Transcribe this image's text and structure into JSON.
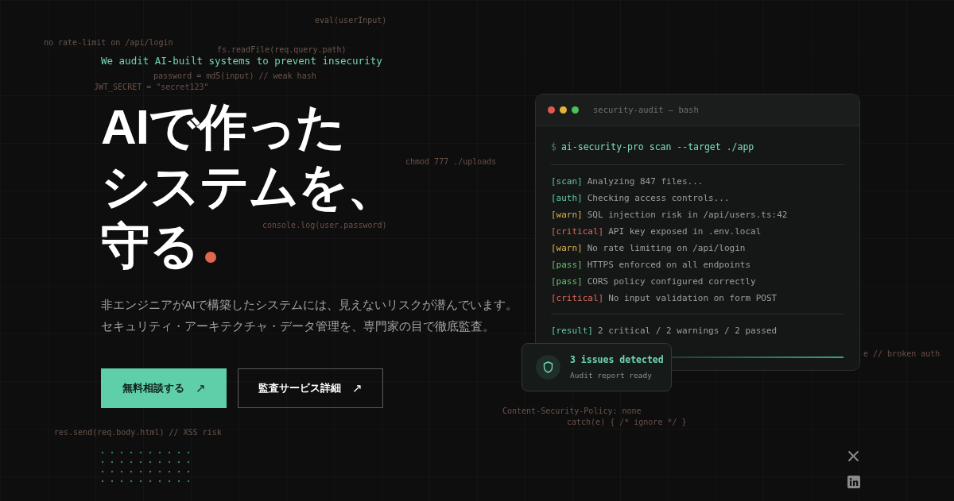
{
  "background_code": [
    {
      "text": "eval(userInput)"
    },
    {
      "text": "no rate-limit on /api/login"
    },
    {
      "text": "fs.readFile(req.query.path)"
    },
    {
      "text": "password = md5(input) // weak hash"
    },
    {
      "text": "JWT_SECRET = \"secret123\""
    },
    {
      "text": "chmod 777 ./uploads"
    },
    {
      "text": "console.log(user.password)"
    },
    {
      "text": "e // broken auth"
    },
    {
      "text": "Content-Security-Policy: none"
    },
    {
      "text": "catch(e) { /* ignore */ }"
    },
    {
      "text": "res.send(req.body.html) // XSS risk"
    }
  ],
  "hero": {
    "tagline": "We audit AI-built systems to prevent insecurity",
    "heading_lines": [
      "AIで作った",
      "システムを、",
      "守る"
    ],
    "description_lines": [
      "非エンジニアがAIで構築したシステムには、見えないリスクが潜んでいます。",
      "セキュリティ・アーキテクチャ・データ管理を、専門家の目で徹底監査。"
    ],
    "buttons": [
      {
        "label": "無料相談する",
        "icon": "↗",
        "kind": "primary"
      },
      {
        "label": "監査サービス詳細",
        "icon": "↗",
        "kind": "secondary"
      }
    ]
  },
  "terminal": {
    "title": "security-audit — bash",
    "command": {
      "prompt": "$",
      "text": "ai-security-pro scan --target ./app"
    },
    "logs": [
      {
        "tag": "[scan]",
        "kind": "info",
        "message": "Analyzing 847 files..."
      },
      {
        "tag": "[auth]",
        "kind": "info",
        "message": "Checking access controls..."
      },
      {
        "tag": "[warn]",
        "kind": "warn",
        "message": "SQL injection risk in /api/users.ts:42"
      },
      {
        "tag": "[critical]",
        "kind": "critical",
        "message": "API key exposed in .env.local"
      },
      {
        "tag": "[warn]",
        "kind": "warn",
        "message": "No rate limiting on /api/login"
      },
      {
        "tag": "[pass]",
        "kind": "pass",
        "message": "HTTPS enforced on all endpoints"
      },
      {
        "tag": "[pass]",
        "kind": "pass",
        "message": "CORS policy configured correctly"
      },
      {
        "tag": "[critical]",
        "kind": "critical",
        "message": "No input validation on form POST"
      }
    ],
    "result": {
      "tag": "[result]",
      "message": "2 critical / 2 warnings / 2 passed"
    }
  },
  "toast": {
    "title": "3 issues detected",
    "subtitle": "Audit report ready"
  }
}
